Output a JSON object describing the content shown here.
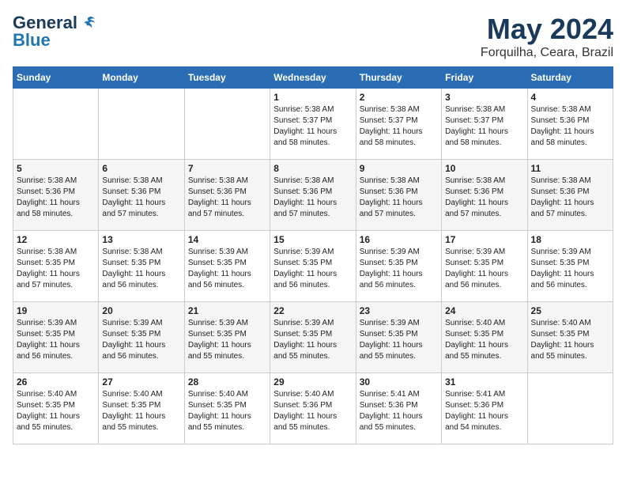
{
  "logo": {
    "line1": "General",
    "line2": "Blue"
  },
  "title": "May 2024",
  "location": "Forquilha, Ceara, Brazil",
  "days_of_week": [
    "Sunday",
    "Monday",
    "Tuesday",
    "Wednesday",
    "Thursday",
    "Friday",
    "Saturday"
  ],
  "weeks": [
    [
      {
        "num": "",
        "info": ""
      },
      {
        "num": "",
        "info": ""
      },
      {
        "num": "",
        "info": ""
      },
      {
        "num": "1",
        "info": "Sunrise: 5:38 AM\nSunset: 5:37 PM\nDaylight: 11 hours\nand 58 minutes."
      },
      {
        "num": "2",
        "info": "Sunrise: 5:38 AM\nSunset: 5:37 PM\nDaylight: 11 hours\nand 58 minutes."
      },
      {
        "num": "3",
        "info": "Sunrise: 5:38 AM\nSunset: 5:37 PM\nDaylight: 11 hours\nand 58 minutes."
      },
      {
        "num": "4",
        "info": "Sunrise: 5:38 AM\nSunset: 5:36 PM\nDaylight: 11 hours\nand 58 minutes."
      }
    ],
    [
      {
        "num": "5",
        "info": "Sunrise: 5:38 AM\nSunset: 5:36 PM\nDaylight: 11 hours\nand 58 minutes."
      },
      {
        "num": "6",
        "info": "Sunrise: 5:38 AM\nSunset: 5:36 PM\nDaylight: 11 hours\nand 57 minutes."
      },
      {
        "num": "7",
        "info": "Sunrise: 5:38 AM\nSunset: 5:36 PM\nDaylight: 11 hours\nand 57 minutes."
      },
      {
        "num": "8",
        "info": "Sunrise: 5:38 AM\nSunset: 5:36 PM\nDaylight: 11 hours\nand 57 minutes."
      },
      {
        "num": "9",
        "info": "Sunrise: 5:38 AM\nSunset: 5:36 PM\nDaylight: 11 hours\nand 57 minutes."
      },
      {
        "num": "10",
        "info": "Sunrise: 5:38 AM\nSunset: 5:36 PM\nDaylight: 11 hours\nand 57 minutes."
      },
      {
        "num": "11",
        "info": "Sunrise: 5:38 AM\nSunset: 5:36 PM\nDaylight: 11 hours\nand 57 minutes."
      }
    ],
    [
      {
        "num": "12",
        "info": "Sunrise: 5:38 AM\nSunset: 5:35 PM\nDaylight: 11 hours\nand 57 minutes."
      },
      {
        "num": "13",
        "info": "Sunrise: 5:38 AM\nSunset: 5:35 PM\nDaylight: 11 hours\nand 56 minutes."
      },
      {
        "num": "14",
        "info": "Sunrise: 5:39 AM\nSunset: 5:35 PM\nDaylight: 11 hours\nand 56 minutes."
      },
      {
        "num": "15",
        "info": "Sunrise: 5:39 AM\nSunset: 5:35 PM\nDaylight: 11 hours\nand 56 minutes."
      },
      {
        "num": "16",
        "info": "Sunrise: 5:39 AM\nSunset: 5:35 PM\nDaylight: 11 hours\nand 56 minutes."
      },
      {
        "num": "17",
        "info": "Sunrise: 5:39 AM\nSunset: 5:35 PM\nDaylight: 11 hours\nand 56 minutes."
      },
      {
        "num": "18",
        "info": "Sunrise: 5:39 AM\nSunset: 5:35 PM\nDaylight: 11 hours\nand 56 minutes."
      }
    ],
    [
      {
        "num": "19",
        "info": "Sunrise: 5:39 AM\nSunset: 5:35 PM\nDaylight: 11 hours\nand 56 minutes."
      },
      {
        "num": "20",
        "info": "Sunrise: 5:39 AM\nSunset: 5:35 PM\nDaylight: 11 hours\nand 56 minutes."
      },
      {
        "num": "21",
        "info": "Sunrise: 5:39 AM\nSunset: 5:35 PM\nDaylight: 11 hours\nand 55 minutes."
      },
      {
        "num": "22",
        "info": "Sunrise: 5:39 AM\nSunset: 5:35 PM\nDaylight: 11 hours\nand 55 minutes."
      },
      {
        "num": "23",
        "info": "Sunrise: 5:39 AM\nSunset: 5:35 PM\nDaylight: 11 hours\nand 55 minutes."
      },
      {
        "num": "24",
        "info": "Sunrise: 5:40 AM\nSunset: 5:35 PM\nDaylight: 11 hours\nand 55 minutes."
      },
      {
        "num": "25",
        "info": "Sunrise: 5:40 AM\nSunset: 5:35 PM\nDaylight: 11 hours\nand 55 minutes."
      }
    ],
    [
      {
        "num": "26",
        "info": "Sunrise: 5:40 AM\nSunset: 5:35 PM\nDaylight: 11 hours\nand 55 minutes."
      },
      {
        "num": "27",
        "info": "Sunrise: 5:40 AM\nSunset: 5:35 PM\nDaylight: 11 hours\nand 55 minutes."
      },
      {
        "num": "28",
        "info": "Sunrise: 5:40 AM\nSunset: 5:35 PM\nDaylight: 11 hours\nand 55 minutes."
      },
      {
        "num": "29",
        "info": "Sunrise: 5:40 AM\nSunset: 5:36 PM\nDaylight: 11 hours\nand 55 minutes."
      },
      {
        "num": "30",
        "info": "Sunrise: 5:41 AM\nSunset: 5:36 PM\nDaylight: 11 hours\nand 55 minutes."
      },
      {
        "num": "31",
        "info": "Sunrise: 5:41 AM\nSunset: 5:36 PM\nDaylight: 11 hours\nand 54 minutes."
      },
      {
        "num": "",
        "info": ""
      }
    ]
  ]
}
